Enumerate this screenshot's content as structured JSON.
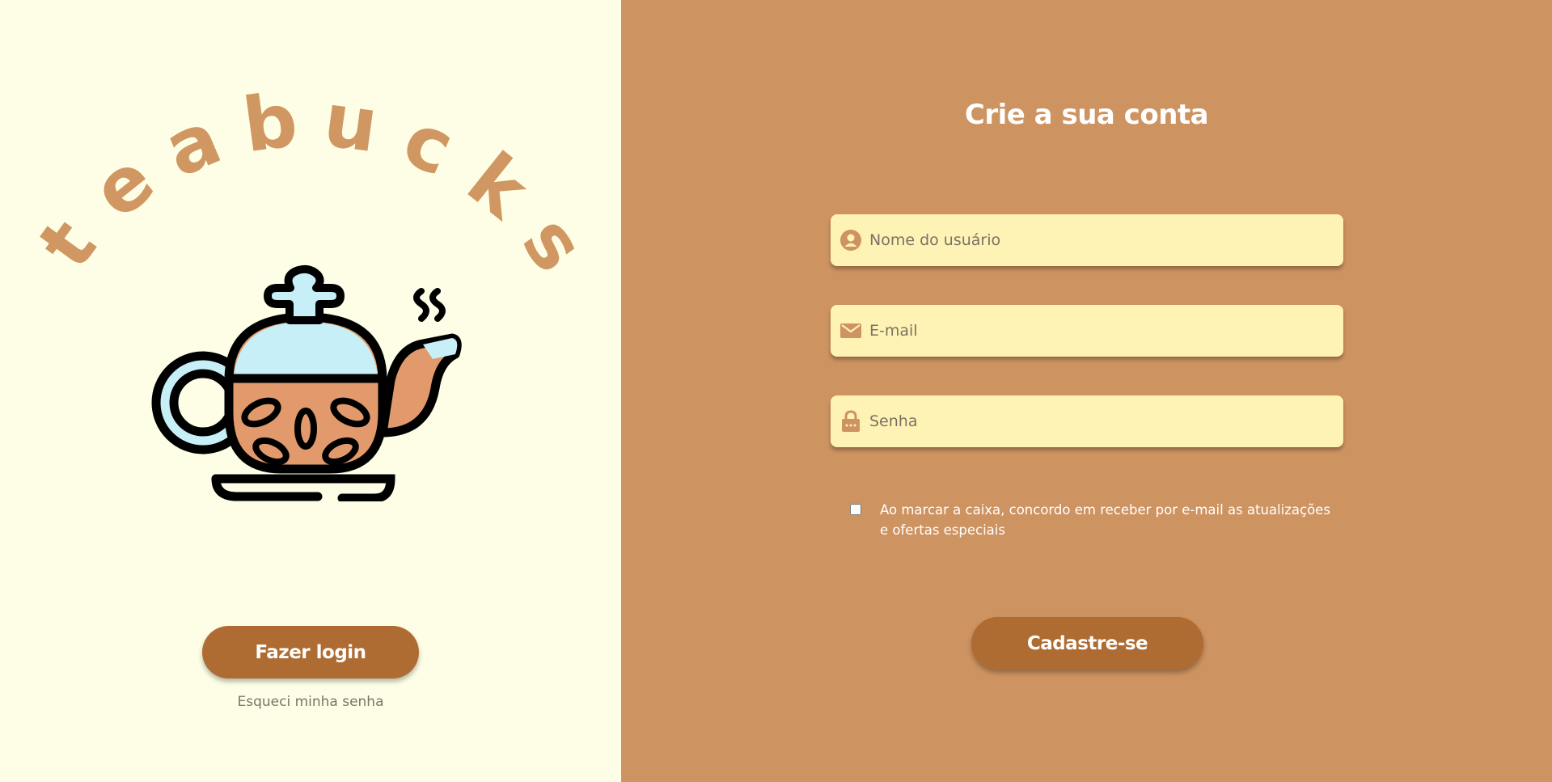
{
  "brand": {
    "name": "teabucks",
    "letters": [
      "t",
      "e",
      "a",
      "b",
      "u",
      "c",
      "k",
      "s"
    ]
  },
  "left": {
    "login_label": "Fazer login",
    "forgot_label": "Esqueci minha senha"
  },
  "form": {
    "title": "Crie a sua conta",
    "username": {
      "placeholder": "Nome do usuário",
      "value": "",
      "icon": "user-icon"
    },
    "email": {
      "placeholder": "E-mail",
      "value": "",
      "icon": "mail-icon"
    },
    "password": {
      "placeholder": "Senha",
      "value": "",
      "icon": "lock-icon"
    },
    "consent_label": "Ao marcar a caixa, concordo em receber por e-mail as atualizações e ofertas especiais",
    "consent_checked": false,
    "signup_label": "Cadastre-se"
  },
  "colors": {
    "left_bg": "#fdfee5",
    "right_bg": "#cd9361",
    "brand_text": "#d09762",
    "button_bg": "#ae6c32",
    "field_bg": "#fff2b5"
  }
}
